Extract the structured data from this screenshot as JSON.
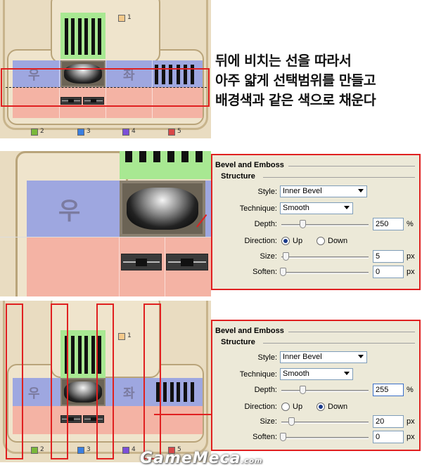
{
  "caption": {
    "line1": "뒤에 비치는 선을 따라서",
    "line2": "아주 얇게 선택범위를 만들고",
    "line3": "배경색과 같은 색으로 채운다"
  },
  "board": {
    "left_glyph": "우",
    "right_glyph": "좌",
    "layer_top_number": "1",
    "swatches": [
      {
        "number": "2",
        "color": "#7ab83a"
      },
      {
        "number": "3",
        "color": "#3b7fe0"
      },
      {
        "number": "4",
        "color": "#7b4fd8"
      },
      {
        "number": "5",
        "color": "#d84848"
      }
    ],
    "top_swatch_color": "#f4c98a"
  },
  "colors": {
    "highlight_red": "#e02020",
    "green": "#a8e892",
    "blue": "#9ea7e0",
    "pink": "#f4b3a4"
  },
  "panel1": {
    "title": "Bevel and Emboss",
    "subtitle": "Structure",
    "style_label": "Style:",
    "style_value": "Inner Bevel",
    "technique_label": "Technique:",
    "technique_value": "Smooth",
    "depth_label": "Depth:",
    "depth_value": "250",
    "depth_unit": "%",
    "direction_label": "Direction:",
    "up_label": "Up",
    "down_label": "Down",
    "direction_selected": "Up",
    "size_label": "Size:",
    "size_value": "5",
    "size_unit": "px",
    "soften_label": "Soften:",
    "soften_value": "0",
    "soften_unit": "px"
  },
  "panel2": {
    "title": "Bevel and Emboss",
    "subtitle": "Structure",
    "style_label": "Style:",
    "style_value": "Inner Bevel",
    "technique_label": "Technique:",
    "technique_value": "Smooth",
    "depth_label": "Depth:",
    "depth_value": "255",
    "depth_unit": "%",
    "direction_label": "Direction:",
    "up_label": "Up",
    "down_label": "Down",
    "direction_selected": "Down",
    "size_label": "Size:",
    "size_value": "20",
    "size_unit": "px",
    "soften_label": "Soften:",
    "soften_value": "0",
    "soften_unit": "px"
  },
  "watermark": {
    "text": "GameMeca",
    "suffix": ".com"
  }
}
